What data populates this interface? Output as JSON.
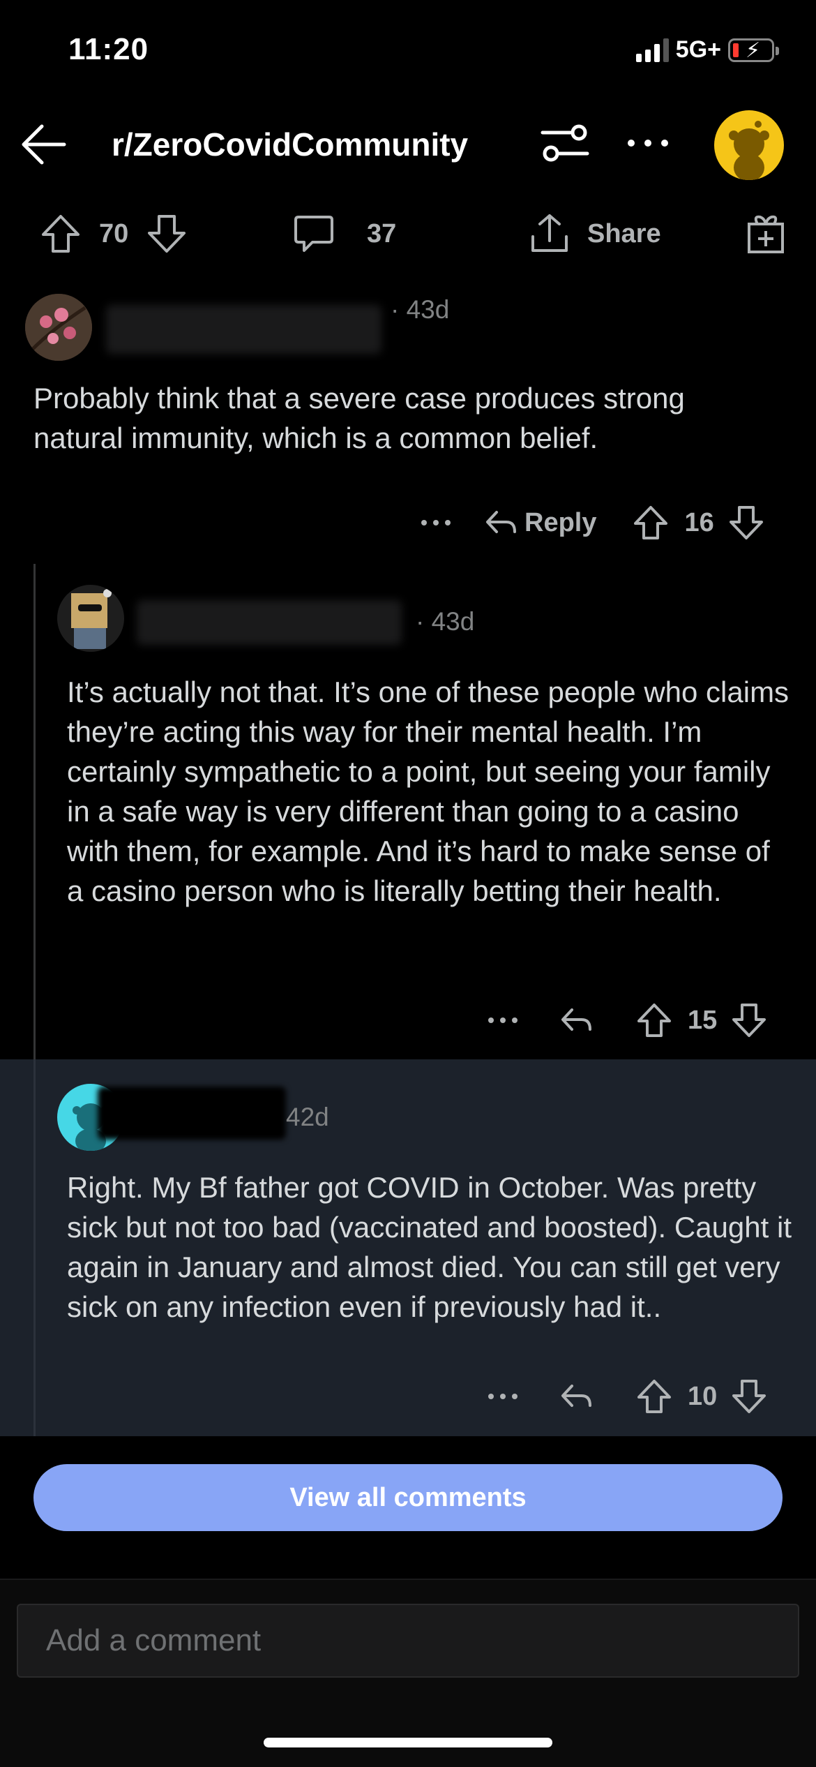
{
  "status_bar": {
    "time": "11:20",
    "network": "5G+"
  },
  "nav": {
    "title": "r/ZeroCovidCommunity",
    "icons": [
      "back-arrow-icon",
      "filter-icon",
      "more-icon",
      "avatar"
    ]
  },
  "post_actions": {
    "upvotes": "70",
    "comments": "37",
    "share_label": "Share"
  },
  "comments": [
    {
      "age": "· 43d",
      "text": "Probably think that a severe case produces strong natural immunity, which is a common belief.",
      "reply_label": "Reply",
      "score": "16"
    },
    {
      "age": "· 43d",
      "text": "It’s actually not that. It’s one of these people who claims they’re acting this way for their mental health. I’m certainly sympathetic to a point, but seeing your family in a safe way is very different than going to a casino with them, for example. And it’s hard to make sense of a casino person who is literally betting their health.",
      "score": "15"
    },
    {
      "age": "42d",
      "text": "Right. My Bf father got COVID in October. Was pretty sick but not too bad (vaccinated and boosted). Caught it again in January and almost died. You can still get very sick on any infection even if previously had it..",
      "score": "10"
    }
  ],
  "view_all_label": "View all comments",
  "composer": {
    "placeholder": "Add a comment"
  },
  "colors": {
    "background": "#000000",
    "highlight": "#1c222b",
    "view_all_button": "#88a5f6",
    "text": "#d7dadc",
    "muted": "#818384"
  }
}
